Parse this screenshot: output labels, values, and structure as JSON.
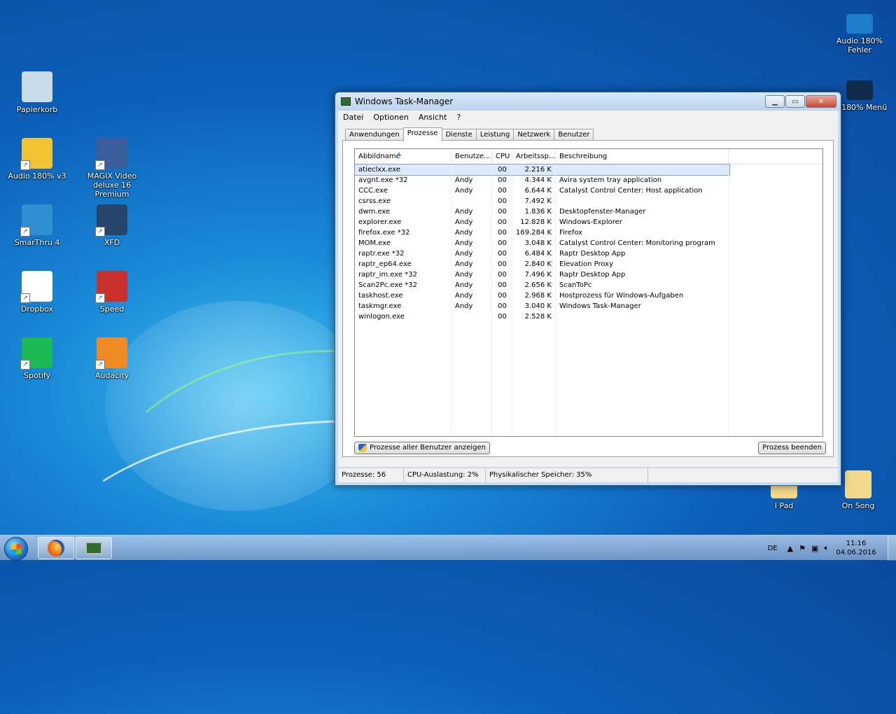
{
  "desktop": {
    "icons_left": [
      {
        "label": "Papierkorb",
        "icon": "recycle-bin-icon",
        "color": "#c9dbe8",
        "shortcut": false
      },
      {
        "label": "Audio 180% v3",
        "icon": "audio-folder-icon",
        "color": "#f1c232",
        "shortcut": true
      },
      {
        "label": "MAGIX Video deluxe 16 Premium",
        "icon": "magix-icon",
        "color": "#3b5d9c",
        "shortcut": true
      },
      {
        "label": "SmarThru 4",
        "icon": "smarthru-icon",
        "color": "#2f8fd0",
        "shortcut": true
      },
      {
        "label": "XFD",
        "icon": "xfd-icon",
        "color": "#27456b",
        "shortcut": true
      },
      {
        "label": "Dropbox",
        "icon": "dropbox-icon",
        "color": "#ffffff",
        "shortcut": true
      },
      {
        "label": "Speed",
        "icon": "speed-icon",
        "color": "#c9302c",
        "shortcut": true
      },
      {
        "label": "Spotify",
        "icon": "spotify-icon",
        "color": "#1db954",
        "shortcut": true
      },
      {
        "label": "Audacity",
        "icon": "audacity-icon",
        "color": "#f08a24",
        "shortcut": true
      }
    ],
    "icons_right": [
      {
        "label": "Audio 180% Fehler",
        "icon": "audio-error-icon",
        "color": "#1e7ccc"
      },
      {
        "label": "io 180% Menü",
        "icon": "audio-menu-icon",
        "color": "#102a4a"
      },
      {
        "label": "I Pad",
        "icon": "ipad-folder-icon",
        "color": "#f2d88a"
      },
      {
        "label": "On Song",
        "icon": "onsong-folder-icon",
        "color": "#f2d88a"
      }
    ]
  },
  "window": {
    "title": "Windows Task-Manager",
    "menu": [
      "Datei",
      "Optionen",
      "Ansicht",
      "?"
    ],
    "tabs": [
      "Anwendungen",
      "Prozesse",
      "Dienste",
      "Leistung",
      "Netzwerk",
      "Benutzer"
    ],
    "active_tab": 1,
    "columns": [
      "Abbildname",
      "Benutze...",
      "CPU",
      "Arbeitssp...",
      "Beschreibung"
    ],
    "processes": [
      {
        "name": "atieclxx.exe",
        "user": "",
        "cpu": "00",
        "mem": "2.216 K",
        "desc": ""
      },
      {
        "name": "avgnt.exe *32",
        "user": "Andy",
        "cpu": "00",
        "mem": "4.344 K",
        "desc": "Avira system tray application"
      },
      {
        "name": "CCC.exe",
        "user": "Andy",
        "cpu": "00",
        "mem": "6.644 K",
        "desc": "Catalyst Control Center: Host application"
      },
      {
        "name": "csrss.exe",
        "user": "",
        "cpu": "00",
        "mem": "7.492 K",
        "desc": ""
      },
      {
        "name": "dwm.exe",
        "user": "Andy",
        "cpu": "00",
        "mem": "1.836 K",
        "desc": "Desktopfenster-Manager"
      },
      {
        "name": "explorer.exe",
        "user": "Andy",
        "cpu": "00",
        "mem": "12.828 K",
        "desc": "Windows-Explorer"
      },
      {
        "name": "firefox.exe *32",
        "user": "Andy",
        "cpu": "00",
        "mem": "169.284 K",
        "desc": "Firefox"
      },
      {
        "name": "MOM.exe",
        "user": "Andy",
        "cpu": "00",
        "mem": "3.048 K",
        "desc": "Catalyst Control Center: Monitoring program"
      },
      {
        "name": "raptr.exe *32",
        "user": "Andy",
        "cpu": "00",
        "mem": "6.484 K",
        "desc": "Raptr Desktop App"
      },
      {
        "name": "raptr_ep64.exe",
        "user": "Andy",
        "cpu": "00",
        "mem": "2.840 K",
        "desc": "Elevation Proxy"
      },
      {
        "name": "raptr_im.exe *32",
        "user": "Andy",
        "cpu": "00",
        "mem": "7.496 K",
        "desc": "Raptr Desktop App"
      },
      {
        "name": "Scan2Pc.exe *32",
        "user": "Andy",
        "cpu": "00",
        "mem": "2.656 K",
        "desc": "ScanToPc"
      },
      {
        "name": "taskhost.exe",
        "user": "Andy",
        "cpu": "00",
        "mem": "2.968 K",
        "desc": "Hostprozess für Windows-Aufgaben"
      },
      {
        "name": "taskmgr.exe",
        "user": "Andy",
        "cpu": "00",
        "mem": "3.040 K",
        "desc": "Windows Task-Manager"
      },
      {
        "name": "winlogon.exe",
        "user": "",
        "cpu": "00",
        "mem": "2.528 K",
        "desc": ""
      }
    ],
    "show_all_button": "Prozesse aller Benutzer anzeigen",
    "end_process_button": "Prozess beenden",
    "status": {
      "processes": "Prozesse: 56",
      "cpu": "CPU-Auslastung: 2%",
      "memory": "Physikalischer Speicher: 35%"
    }
  },
  "taskbar": {
    "language": "DE",
    "time": "11:16",
    "date": "04.06.2016"
  }
}
